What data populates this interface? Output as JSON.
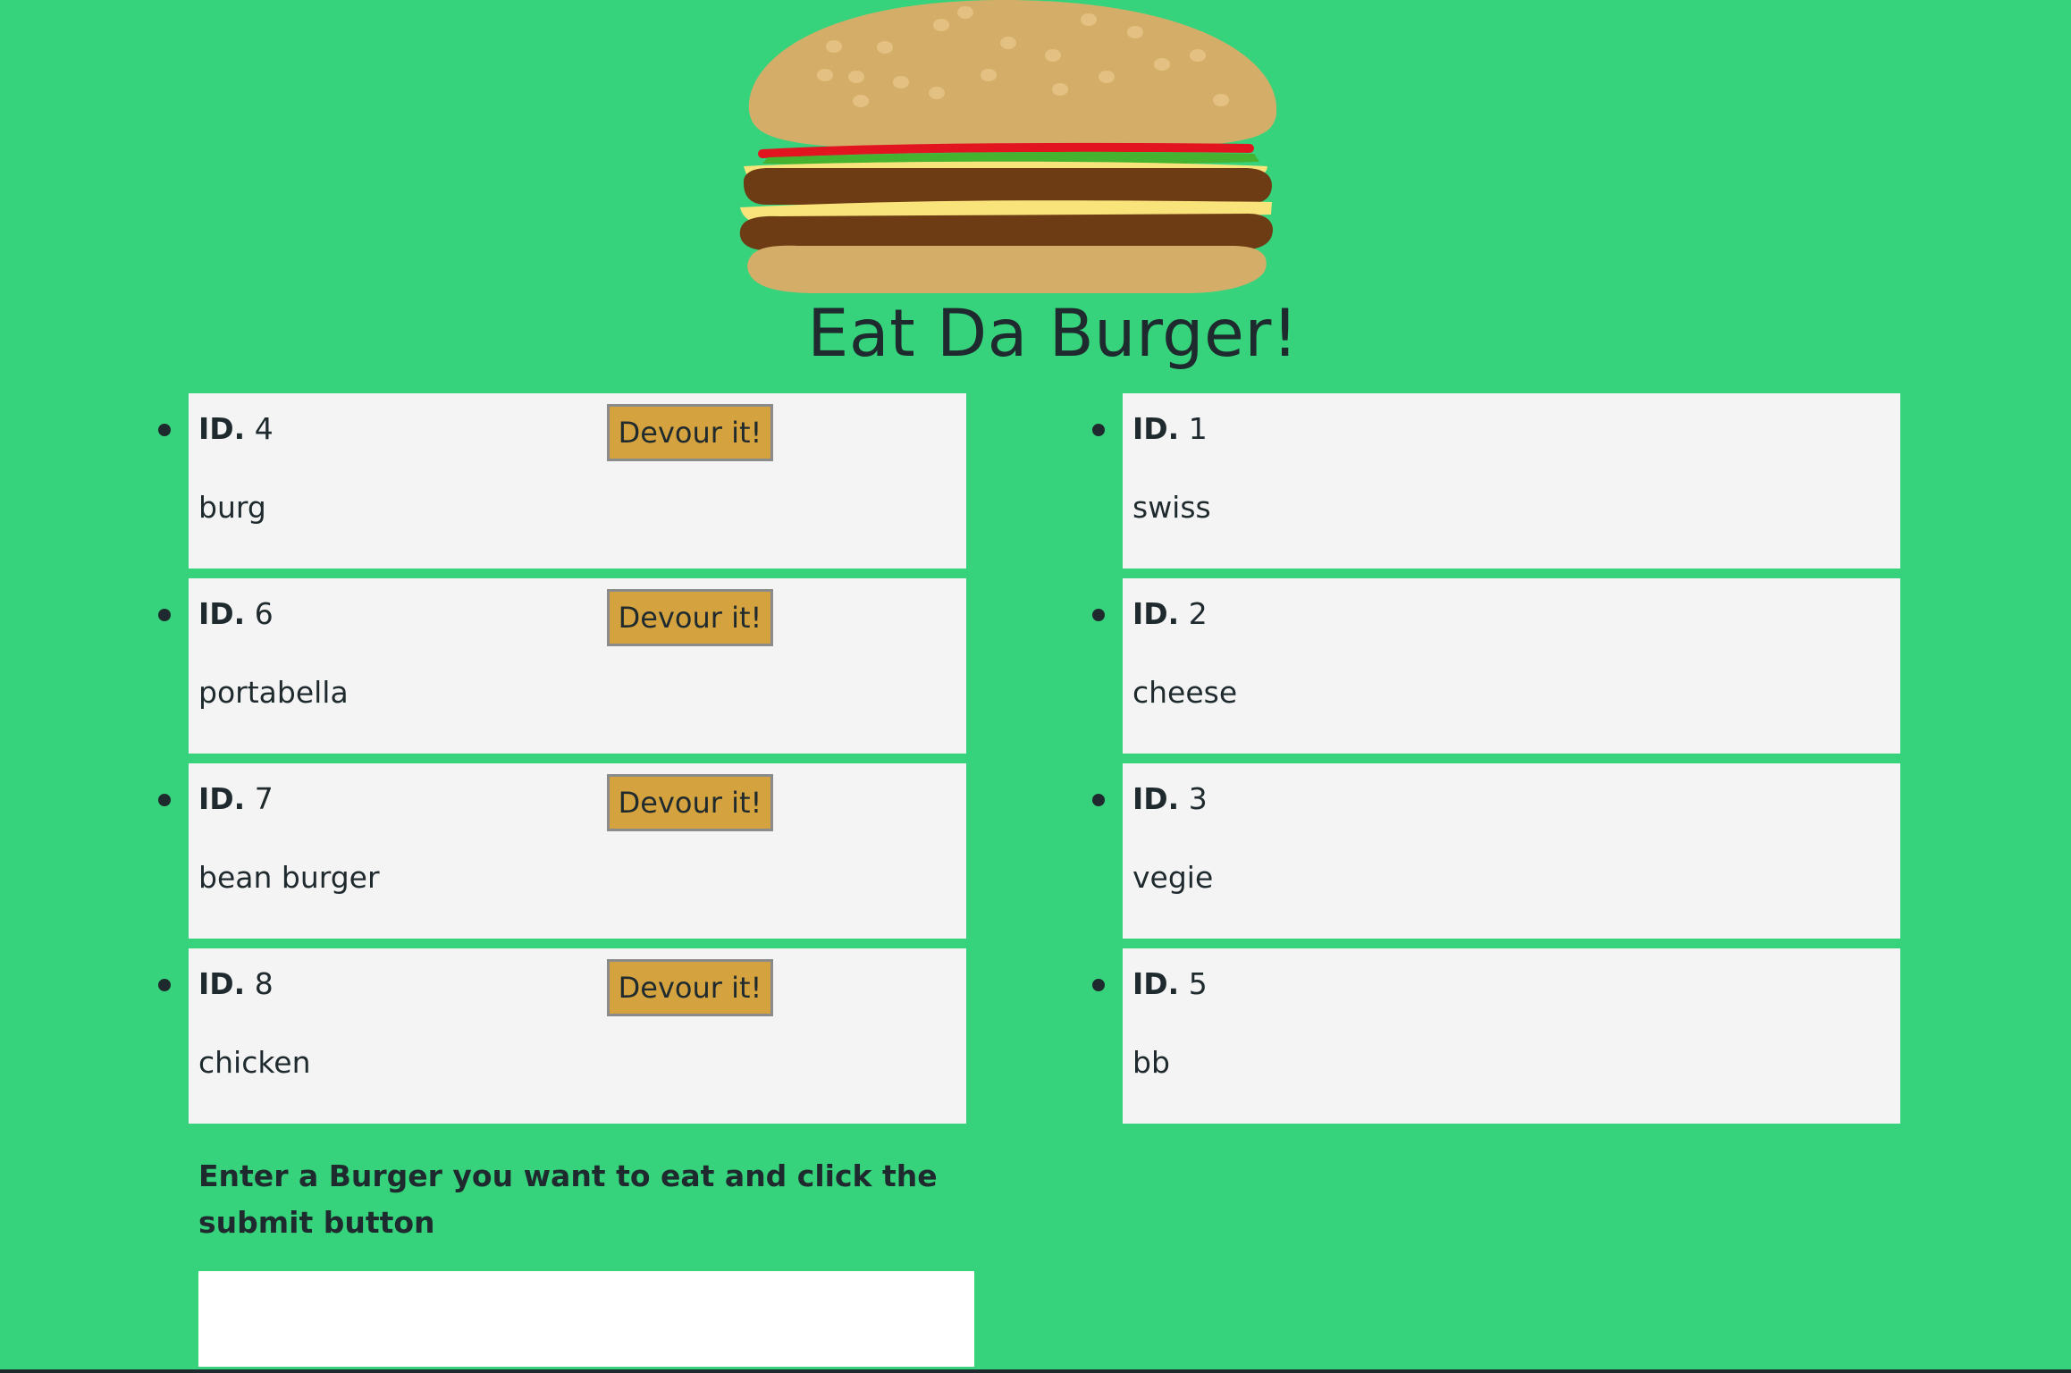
{
  "page": {
    "title": "Eat Da Burger!",
    "background_color": "#36d37c",
    "logo_icon": "burger-illustration"
  },
  "burgers": {
    "uneaten": [
      {
        "id_label": "ID.",
        "id": "4",
        "name": "burg",
        "button_label": "Devour it!"
      },
      {
        "id_label": "ID.",
        "id": "6",
        "name": "portabella",
        "button_label": "Devour it!"
      },
      {
        "id_label": "ID.",
        "id": "7",
        "name": "bean burger",
        "button_label": "Devour it!"
      },
      {
        "id_label": "ID.",
        "id": "8",
        "name": "chicken",
        "button_label": "Devour it!"
      }
    ],
    "devoured": [
      {
        "id_label": "ID.",
        "id": "1",
        "name": "swiss"
      },
      {
        "id_label": "ID.",
        "id": "2",
        "name": "cheese"
      },
      {
        "id_label": "ID.",
        "id": "3",
        "name": "vegie"
      },
      {
        "id_label": "ID.",
        "id": "5",
        "name": "bb"
      }
    ]
  },
  "form": {
    "label": "Enter a Burger you want to eat and click the submit button",
    "input_value": "",
    "input_placeholder": ""
  },
  "colors": {
    "card_background": "#f4f4f4",
    "button_background": "#d4a23e",
    "text": "#1f2a2e",
    "bun": "#d4ae68",
    "patty": "#6e3c14",
    "cheese": "#f8e47a",
    "lettuce": "#45b32f",
    "ketchup": "#e1141f"
  }
}
